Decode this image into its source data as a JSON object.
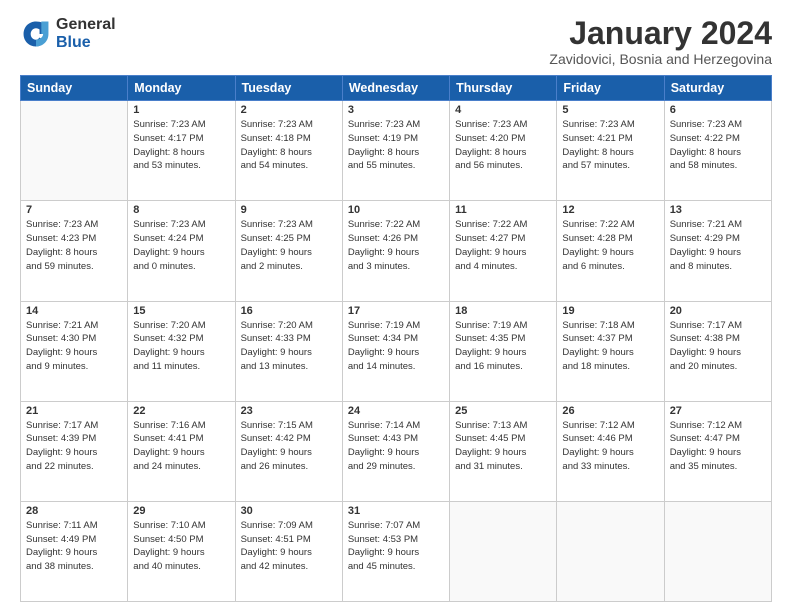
{
  "header": {
    "logo_general": "General",
    "logo_blue": "Blue",
    "main_title": "January 2024",
    "subtitle": "Zavidovici, Bosnia and Herzegovina"
  },
  "calendar": {
    "days_of_week": [
      "Sunday",
      "Monday",
      "Tuesday",
      "Wednesday",
      "Thursday",
      "Friday",
      "Saturday"
    ],
    "weeks": [
      [
        {
          "day": "",
          "info": ""
        },
        {
          "day": "1",
          "info": "Sunrise: 7:23 AM\nSunset: 4:17 PM\nDaylight: 8 hours\nand 53 minutes."
        },
        {
          "day": "2",
          "info": "Sunrise: 7:23 AM\nSunset: 4:18 PM\nDaylight: 8 hours\nand 54 minutes."
        },
        {
          "day": "3",
          "info": "Sunrise: 7:23 AM\nSunset: 4:19 PM\nDaylight: 8 hours\nand 55 minutes."
        },
        {
          "day": "4",
          "info": "Sunrise: 7:23 AM\nSunset: 4:20 PM\nDaylight: 8 hours\nand 56 minutes."
        },
        {
          "day": "5",
          "info": "Sunrise: 7:23 AM\nSunset: 4:21 PM\nDaylight: 8 hours\nand 57 minutes."
        },
        {
          "day": "6",
          "info": "Sunrise: 7:23 AM\nSunset: 4:22 PM\nDaylight: 8 hours\nand 58 minutes."
        }
      ],
      [
        {
          "day": "7",
          "info": "Sunrise: 7:23 AM\nSunset: 4:23 PM\nDaylight: 8 hours\nand 59 minutes."
        },
        {
          "day": "8",
          "info": "Sunrise: 7:23 AM\nSunset: 4:24 PM\nDaylight: 9 hours\nand 0 minutes."
        },
        {
          "day": "9",
          "info": "Sunrise: 7:23 AM\nSunset: 4:25 PM\nDaylight: 9 hours\nand 2 minutes."
        },
        {
          "day": "10",
          "info": "Sunrise: 7:22 AM\nSunset: 4:26 PM\nDaylight: 9 hours\nand 3 minutes."
        },
        {
          "day": "11",
          "info": "Sunrise: 7:22 AM\nSunset: 4:27 PM\nDaylight: 9 hours\nand 4 minutes."
        },
        {
          "day": "12",
          "info": "Sunrise: 7:22 AM\nSunset: 4:28 PM\nDaylight: 9 hours\nand 6 minutes."
        },
        {
          "day": "13",
          "info": "Sunrise: 7:21 AM\nSunset: 4:29 PM\nDaylight: 9 hours\nand 8 minutes."
        }
      ],
      [
        {
          "day": "14",
          "info": "Sunrise: 7:21 AM\nSunset: 4:30 PM\nDaylight: 9 hours\nand 9 minutes."
        },
        {
          "day": "15",
          "info": "Sunrise: 7:20 AM\nSunset: 4:32 PM\nDaylight: 9 hours\nand 11 minutes."
        },
        {
          "day": "16",
          "info": "Sunrise: 7:20 AM\nSunset: 4:33 PM\nDaylight: 9 hours\nand 13 minutes."
        },
        {
          "day": "17",
          "info": "Sunrise: 7:19 AM\nSunset: 4:34 PM\nDaylight: 9 hours\nand 14 minutes."
        },
        {
          "day": "18",
          "info": "Sunrise: 7:19 AM\nSunset: 4:35 PM\nDaylight: 9 hours\nand 16 minutes."
        },
        {
          "day": "19",
          "info": "Sunrise: 7:18 AM\nSunset: 4:37 PM\nDaylight: 9 hours\nand 18 minutes."
        },
        {
          "day": "20",
          "info": "Sunrise: 7:17 AM\nSunset: 4:38 PM\nDaylight: 9 hours\nand 20 minutes."
        }
      ],
      [
        {
          "day": "21",
          "info": "Sunrise: 7:17 AM\nSunset: 4:39 PM\nDaylight: 9 hours\nand 22 minutes."
        },
        {
          "day": "22",
          "info": "Sunrise: 7:16 AM\nSunset: 4:41 PM\nDaylight: 9 hours\nand 24 minutes."
        },
        {
          "day": "23",
          "info": "Sunrise: 7:15 AM\nSunset: 4:42 PM\nDaylight: 9 hours\nand 26 minutes."
        },
        {
          "day": "24",
          "info": "Sunrise: 7:14 AM\nSunset: 4:43 PM\nDaylight: 9 hours\nand 29 minutes."
        },
        {
          "day": "25",
          "info": "Sunrise: 7:13 AM\nSunset: 4:45 PM\nDaylight: 9 hours\nand 31 minutes."
        },
        {
          "day": "26",
          "info": "Sunrise: 7:12 AM\nSunset: 4:46 PM\nDaylight: 9 hours\nand 33 minutes."
        },
        {
          "day": "27",
          "info": "Sunrise: 7:12 AM\nSunset: 4:47 PM\nDaylight: 9 hours\nand 35 minutes."
        }
      ],
      [
        {
          "day": "28",
          "info": "Sunrise: 7:11 AM\nSunset: 4:49 PM\nDaylight: 9 hours\nand 38 minutes."
        },
        {
          "day": "29",
          "info": "Sunrise: 7:10 AM\nSunset: 4:50 PM\nDaylight: 9 hours\nand 40 minutes."
        },
        {
          "day": "30",
          "info": "Sunrise: 7:09 AM\nSunset: 4:51 PM\nDaylight: 9 hours\nand 42 minutes."
        },
        {
          "day": "31",
          "info": "Sunrise: 7:07 AM\nSunset: 4:53 PM\nDaylight: 9 hours\nand 45 minutes."
        },
        {
          "day": "",
          "info": ""
        },
        {
          "day": "",
          "info": ""
        },
        {
          "day": "",
          "info": ""
        }
      ]
    ]
  }
}
